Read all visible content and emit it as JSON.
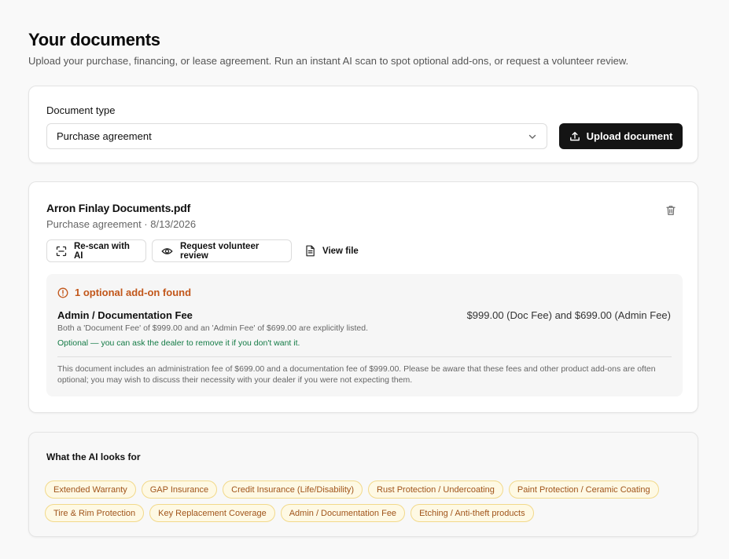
{
  "header": {
    "title": "Your documents",
    "subtitle": "Upload your purchase, financing, or lease agreement. Run an instant AI scan to spot optional add-ons, or request a volunteer review."
  },
  "upload": {
    "label": "Document type",
    "selected": "Purchase agreement",
    "button": "Upload document"
  },
  "document": {
    "name": "Arron Finlay Documents.pdf",
    "meta": "Purchase agreement · 8/13/2026",
    "actions": {
      "rescan": "Re-scan with AI",
      "review": "Request volunteer review",
      "view": "View file"
    },
    "findings": {
      "heading": "1 optional add-on found",
      "item": {
        "title": "Admin / Documentation Fee",
        "amount": "$999.00 (Doc Fee) and $699.00 (Admin Fee)",
        "description": "Both a 'Document Fee' of $999.00 and an 'Admin Fee' of $699.00 are explicitly listed.",
        "note": "Optional — you can ask the dealer to remove it if you don't want it."
      },
      "summary": "This document includes an administration fee of $699.00 and a documentation fee of $999.00. Please be aware that these fees and other product add-ons are often optional; you may wish to discuss their necessity with your dealer if you were not expecting them."
    }
  },
  "looks_for": {
    "title": "What the AI looks for",
    "tags": [
      "Extended Warranty",
      "GAP Insurance",
      "Credit Insurance (Life/Disability)",
      "Rust Protection / Undercoating",
      "Paint Protection / Ceramic Coating",
      "Tire & Rim Protection",
      "Key Replacement Coverage",
      "Admin / Documentation Fee",
      "Etching / Anti-theft products"
    ]
  },
  "colors": {
    "accent_dark": "#141414",
    "warning": "#c2571b",
    "success": "#137a45",
    "tag_bg": "#fef9e4",
    "tag_border": "#f2d98a"
  },
  "icons": {
    "select": "chevron-down-icon",
    "upload": "upload-icon",
    "delete": "trash-icon",
    "rescan": "scan-icon",
    "review": "eye-icon",
    "view": "file-icon",
    "alert": "alert-circle-icon"
  }
}
